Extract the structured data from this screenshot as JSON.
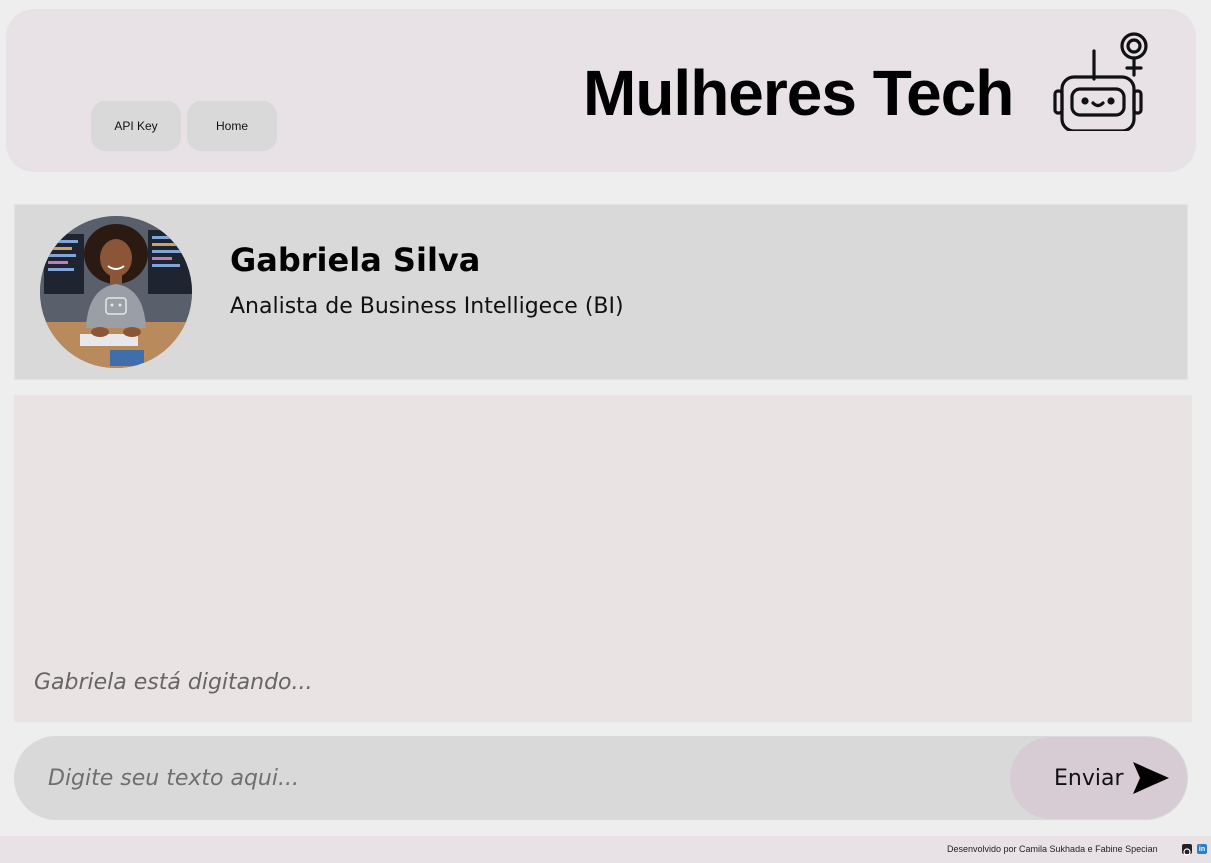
{
  "header": {
    "nav": [
      {
        "label": "API Key"
      },
      {
        "label": "Home"
      }
    ],
    "brand_title": "Mulheres Tech",
    "logo_icon": "robot-female-icon"
  },
  "profile": {
    "name": "Gabriela Silva",
    "role": "Analista de Business Intelligece (BI)",
    "avatar_icon": "avatar-photo"
  },
  "chat": {
    "typing_status": "Gabriela está digitando..."
  },
  "composer": {
    "placeholder": "Digite seu texto aqui...",
    "send_label": "Enviar",
    "send_icon": "send-arrow-icon"
  },
  "footer": {
    "credits": "Desenvolvido por Camila Sukhada e Fabine Specian",
    "github_icon": "github-icon",
    "linkedin_icon": "linkedin-icon",
    "linkedin_glyph": "in"
  },
  "colors": {
    "background": "#eeeeee",
    "header_bg": "#e8e2e7",
    "card_bg": "#d9d9d9",
    "chat_bg": "#e9e3e4",
    "send_bg": "#d8ccd4",
    "linkedin": "#2d7ec7"
  }
}
